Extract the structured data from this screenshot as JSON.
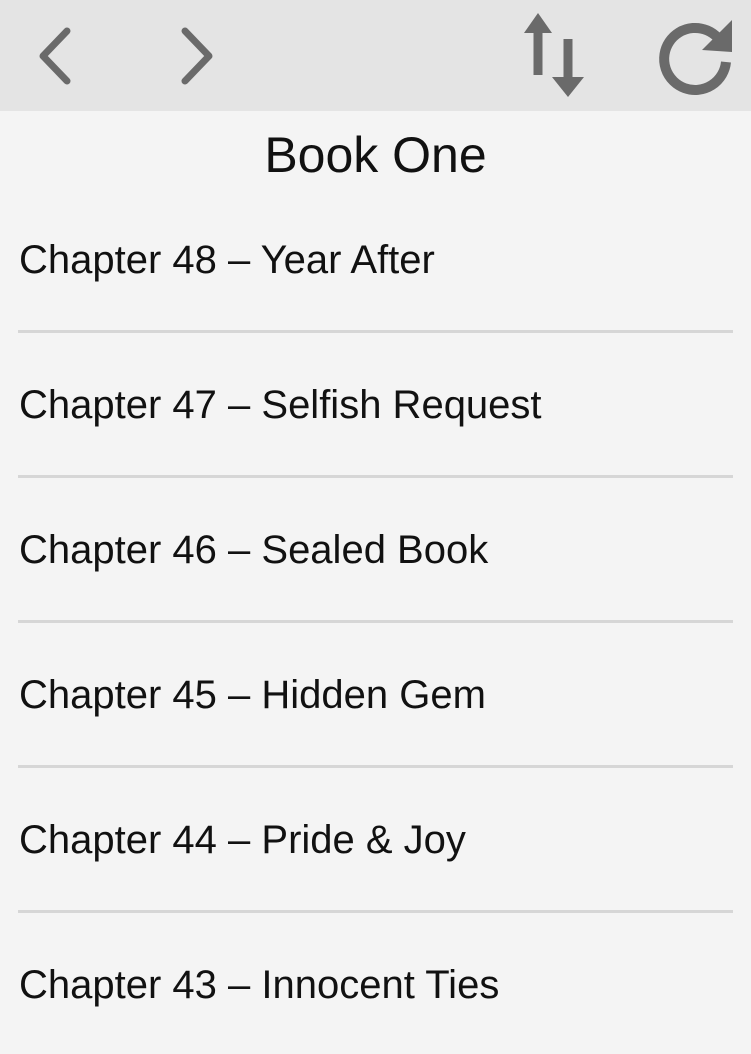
{
  "toolbar": {
    "back": {
      "icon": "chevron-left-icon"
    },
    "forward": {
      "icon": "chevron-right-icon"
    },
    "sort": {
      "icon": "sort-arrows-icon"
    },
    "refresh": {
      "icon": "refresh-icon"
    },
    "icon_color": "#6a6a6a"
  },
  "book": {
    "title": "Book One"
  },
  "chapters": [
    {
      "label": "Chapter 48 – Year After"
    },
    {
      "label": "Chapter 47 – Selfish Request"
    },
    {
      "label": "Chapter 46 – Sealed Book"
    },
    {
      "label": "Chapter 45 – Hidden Gem"
    },
    {
      "label": "Chapter 44 – Pride & Joy"
    },
    {
      "label": "Chapter 43 – Innocent Ties"
    }
  ]
}
